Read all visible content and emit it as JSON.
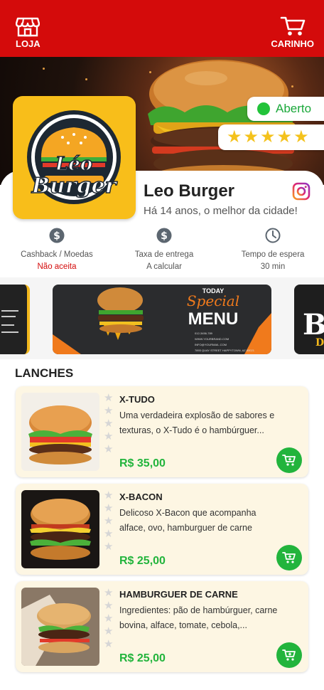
{
  "topbar": {
    "store_label": "LOJA",
    "cart_label": "CARINHO",
    "bg_color": "#d40b0b"
  },
  "store": {
    "name": "Leo Burger",
    "subtitle": "Há 14 anos, o melhor da cidade!",
    "logo_text_top": "Léo",
    "logo_text_bottom": "Burger",
    "status": "Aberto",
    "rating_stars": 5
  },
  "info": [
    {
      "icon": "dollar-icon",
      "label": "Cashback / Moedas",
      "value": "Não aceita",
      "value_color": "#d40b0b"
    },
    {
      "icon": "dollar-icon",
      "label": "Taxa de entrega",
      "value": "A calcular"
    },
    {
      "icon": "clock-icon",
      "label": "Tempo de espera",
      "value": "30 min"
    }
  ],
  "banner": {
    "today": "TODAY",
    "special": "Special",
    "menu": "MENU",
    "contact": [
      "012-3456-789",
      "WWW.YOURBRAND.COM",
      "INFO@YOURMAIL.COM",
      "7893 QUAY STREET HAPPYTOWN, AZ 85021"
    ]
  },
  "section": {
    "title": "LANCHES"
  },
  "products": [
    {
      "name": "X-TUDO",
      "desc": "Uma verdadeira explosão de sabores e texturas, o X-Tudo é o hambúrguer...",
      "price": "R$ 35,00"
    },
    {
      "name": "X-BACON",
      "desc": "Delicoso X-Bacon que acompanha alface, ovo, hamburguer de carne",
      "price": "R$ 25,00"
    },
    {
      "name": "HAMBURGUER DE CARNE",
      "desc": "Ingredientes: pão de hambúrguer, carne bovina, alface, tomate, cebola,...",
      "price": "R$ 25,00"
    }
  ]
}
